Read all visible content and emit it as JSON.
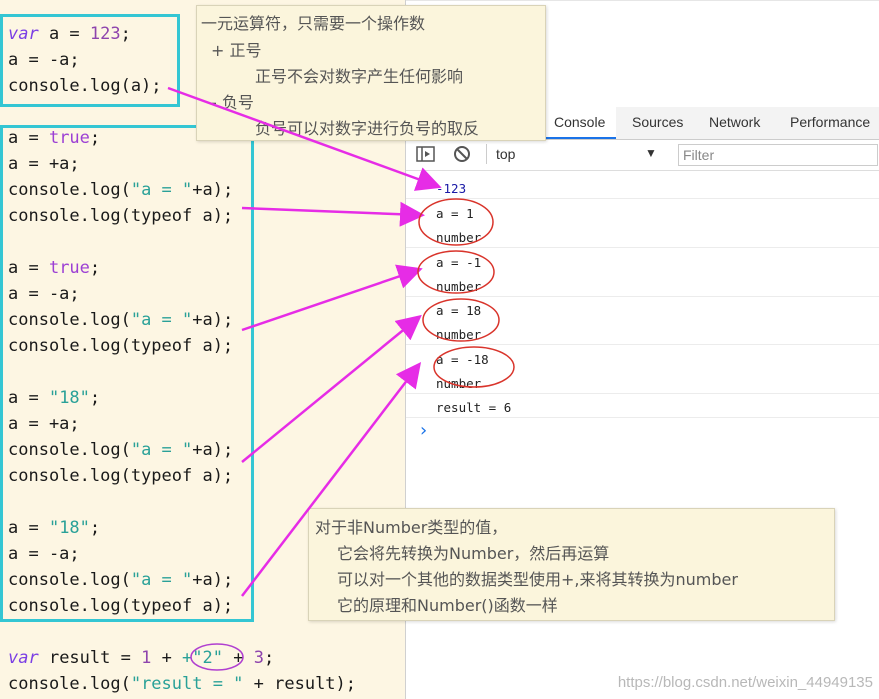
{
  "code": {
    "b1": [
      "var",
      " a = ",
      "123",
      ";",
      "a = -a;",
      "console.log(a);"
    ],
    "b2": {
      "l1a": "a = ",
      "l1b": "true",
      "l1c": ";",
      "l2": "a = +a;",
      "l3a": "console.log(",
      "l3b": "\"a = \"",
      "l3c": "+a);",
      "l4": "console.log(typeof a);"
    },
    "b3": {
      "l1a": "a = ",
      "l1b": "true",
      "l1c": ";",
      "l2": "a = -a;",
      "l3a": "console.log(",
      "l3b": "\"a = \"",
      "l3c": "+a);",
      "l4": "console.log(typeof a);"
    },
    "b4": {
      "l1a": "a = ",
      "l1b": "\"18\"",
      "l1c": ";",
      "l2": "a = +a;",
      "l3a": "console.log(",
      "l3b": "\"a = \"",
      "l3c": "+a);",
      "l4": "console.log(typeof a);"
    },
    "b5": {
      "l1a": "a = ",
      "l1b": "\"18\"",
      "l1c": ";",
      "l2": "a = -a;",
      "l3a": "console.log(",
      "l3b": "\"a = \"",
      "l3c": "+a);",
      "l4": "console.log(typeof a);"
    },
    "b6": {
      "kw": "var",
      "l1a": " result = ",
      "n1": "1",
      "op": " + ",
      "s2": "+\"2\"",
      "op2": " + ",
      "n3": "3",
      "end": ";",
      "l2a": "console.log(",
      "l2b": "\"result = \"",
      "l2c": " + result);"
    }
  },
  "devtools": {
    "tabs": [
      "Console",
      "Sources",
      "Network",
      "Performance"
    ],
    "context": "top",
    "filter_placeholder": "Filter",
    "output": [
      "-123",
      "a = 1",
      "number",
      "a = -1",
      "number",
      "a = 18",
      "number",
      "a = -18",
      "number",
      "result = 6"
    ],
    "prompt": "›"
  },
  "notes": {
    "top": [
      "一元运算符，只需要一个操作数",
      "+ 正号",
      "正号不会对数字产生任何影响",
      "- 负号",
      "负号可以对数字进行负号的取反"
    ],
    "bottom": [
      "对于非Number类型的值，",
      "它会将先转换为Number，然后再运算",
      "可以对一个其他的数据类型使用+,来将其转换为number",
      "它的原理和Number()函数一样"
    ]
  },
  "watermark": "https://blog.csdn.net/weixin_44949135",
  "colors": {
    "box": "#34c6d3",
    "arrow": "#e62ce6",
    "circle": "#d9342b",
    "active_tab": "#1a73e8"
  }
}
